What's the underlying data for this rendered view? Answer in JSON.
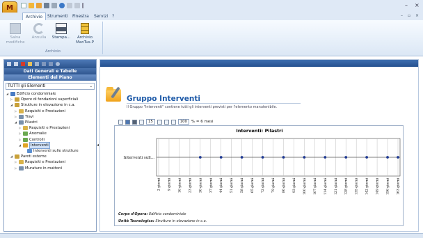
{
  "app": {
    "logo_text": "M"
  },
  "window": {
    "min": "–",
    "close": "×",
    "sub_min": "–",
    "sub_restore": "▫",
    "sub_close": "×"
  },
  "menu": {
    "tabs": [
      "Archivio",
      "Strumenti",
      "Finestra",
      "Servizi",
      "?"
    ],
    "active": 0
  },
  "ribbon": {
    "group_label": "Archivio",
    "buttons": [
      {
        "label_1": "Salva",
        "label_2": "modifiche",
        "disabled": true
      },
      {
        "label_1": "Annulla",
        "label_2": "",
        "disabled": true
      },
      {
        "label_1": "Stampa...",
        "label_2": "",
        "disabled": false
      },
      {
        "label_1": "Archivio",
        "label_2": "ManTus-P",
        "disabled": false
      }
    ]
  },
  "left_panel": {
    "header_1": "Dati Generali e Tabelle",
    "header_2": "Elementi del Piano",
    "filter_value": "TUTTI gli Elementi",
    "tree": [
      {
        "label": "Edificio condominiale",
        "level": 0,
        "exp": "◢",
        "color": "#4a7cc4"
      },
      {
        "label": "Opere di fondazioni superficiali",
        "level": 1,
        "exp": "▷",
        "color": "#c9a13a"
      },
      {
        "label": "Strutture in elevazione in c.a.",
        "level": 1,
        "exp": "◢",
        "color": "#c9a13a"
      },
      {
        "label": "Requisiti e Prestazioni",
        "level": 2,
        "exp": "▷",
        "color": "#d9b34a"
      },
      {
        "label": "Travi",
        "level": 2,
        "exp": "▷",
        "color": "#7890ac"
      },
      {
        "label": "Pilastri",
        "level": 2,
        "exp": "◢",
        "color": "#7890ac"
      },
      {
        "label": "Requisiti e Prestazioni",
        "level": 3,
        "exp": "▷",
        "color": "#d9b34a"
      },
      {
        "label": "Anomalie",
        "level": 3,
        "exp": "▷",
        "color": "#6aa84f"
      },
      {
        "label": "Controlli",
        "level": 3,
        "exp": "▷",
        "color": "#6aa84f"
      },
      {
        "label": "Interventi",
        "level": 3,
        "exp": "◢",
        "color": "#e0a526",
        "selected": true
      },
      {
        "label": "Interventi sulle strutture",
        "level": 4,
        "exp": "",
        "color": "#5b8fd1"
      },
      {
        "label": "Pareti esterne",
        "level": 1,
        "exp": "◢",
        "color": "#c9a13a"
      },
      {
        "label": "Requisiti e Prestazioni",
        "level": 2,
        "exp": "▷",
        "color": "#d9b34a"
      },
      {
        "label": "Murature in mattoni",
        "level": 2,
        "exp": "▷",
        "color": "#7890ac"
      }
    ]
  },
  "main": {
    "title": "Gruppo Interventi",
    "subtitle": "Il Gruppo \"Interventi\" contiene tutti gli interventi previsti per l'elemento manutenibile.",
    "toolbar": {
      "count": "15",
      "zoom": "100",
      "scale_text": "% = 6 mesi"
    },
    "caption_1_label": "Corpo d'Opera:",
    "caption_1_value": "Edificio condominiale",
    "caption_2_label": "Unità Tecnologica:",
    "caption_2_value": "Strutture in elevazione in c.a."
  },
  "chart_data": {
    "type": "scatter",
    "title": "Interventi: Pilastri",
    "categories": [
      "Interventi sull..."
    ],
    "x": [
      "2 giorni",
      "9 giorni",
      "16 giorni",
      "23 giorni",
      "30 giorni",
      "37 giorni",
      "44 giorni",
      "51 giorni",
      "58 giorni",
      "65 giorni",
      "72 giorni",
      "79 giorni",
      "86 giorni",
      "93 giorni",
      "100 giorni",
      "107 giorni",
      "114 giorni",
      "121 giorni",
      "128 giorni",
      "135 giorni",
      "142 giorni",
      "149 giorni",
      "156 giorni",
      "163 giorni"
    ],
    "point_indices": [
      4,
      6,
      8,
      10,
      12,
      14,
      16,
      18,
      20,
      22,
      23
    ],
    "grid": true,
    "point_color": "#1f3a93"
  }
}
